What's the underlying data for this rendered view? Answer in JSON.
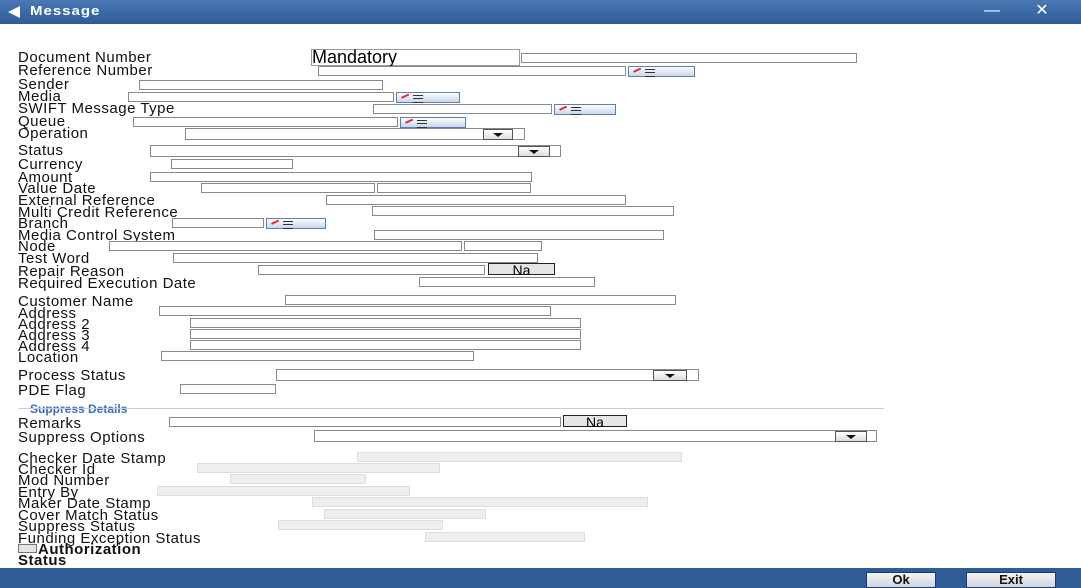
{
  "window": {
    "title": "Message",
    "minimize": "—",
    "close": "✕"
  },
  "fields": {
    "document_number": "Document Number",
    "document_number_placeholder": "Mandatory",
    "reference_number": "Reference Number",
    "sender": "Sender",
    "media": "Media",
    "swift_message_type": "SWIFT Message Type",
    "queue": "Queue",
    "operation": "Operation",
    "status": "Status",
    "currency": "Currency",
    "amount": "Amount",
    "value_date": "Value Date",
    "external_reference": "External Reference",
    "multi_credit_reference": "Multi Credit Reference",
    "branch": "Branch",
    "media_control_system": "Media Control System",
    "node": "Node",
    "test_word": "Test Word",
    "repair_reason": "Repair Reason",
    "required_execution_date": "Required Execution Date",
    "customer_name": "Customer Name",
    "address1": "Address",
    "address2": "Address 2",
    "address3": "Address 3",
    "address4": "Address 4",
    "location": "Location",
    "process_status": "Process Status",
    "pde_flag": "PDE Flag"
  },
  "suppress": {
    "section_title": "Suppress Details",
    "remarks": "Remarks",
    "suppress_options": "Suppress Options"
  },
  "audit": {
    "checker_date_stamp": "Checker Date Stamp",
    "checker_id": "Checker Id",
    "mod_number": "Mod Number",
    "entry_by": "Entry By",
    "maker_date_stamp": "Maker Date Stamp",
    "cover_match_status": "Cover Match Status",
    "suppress_status": "Suppress Status",
    "funding_exception_status": "Funding Exception Status",
    "authorization": "Authorization",
    "status": "Status"
  },
  "buttons": {
    "na": "Na",
    "ok": "Ok",
    "exit": "Exit"
  },
  "colors": {
    "titlebar": "#2f5b97",
    "section": "#3b6cc2"
  }
}
